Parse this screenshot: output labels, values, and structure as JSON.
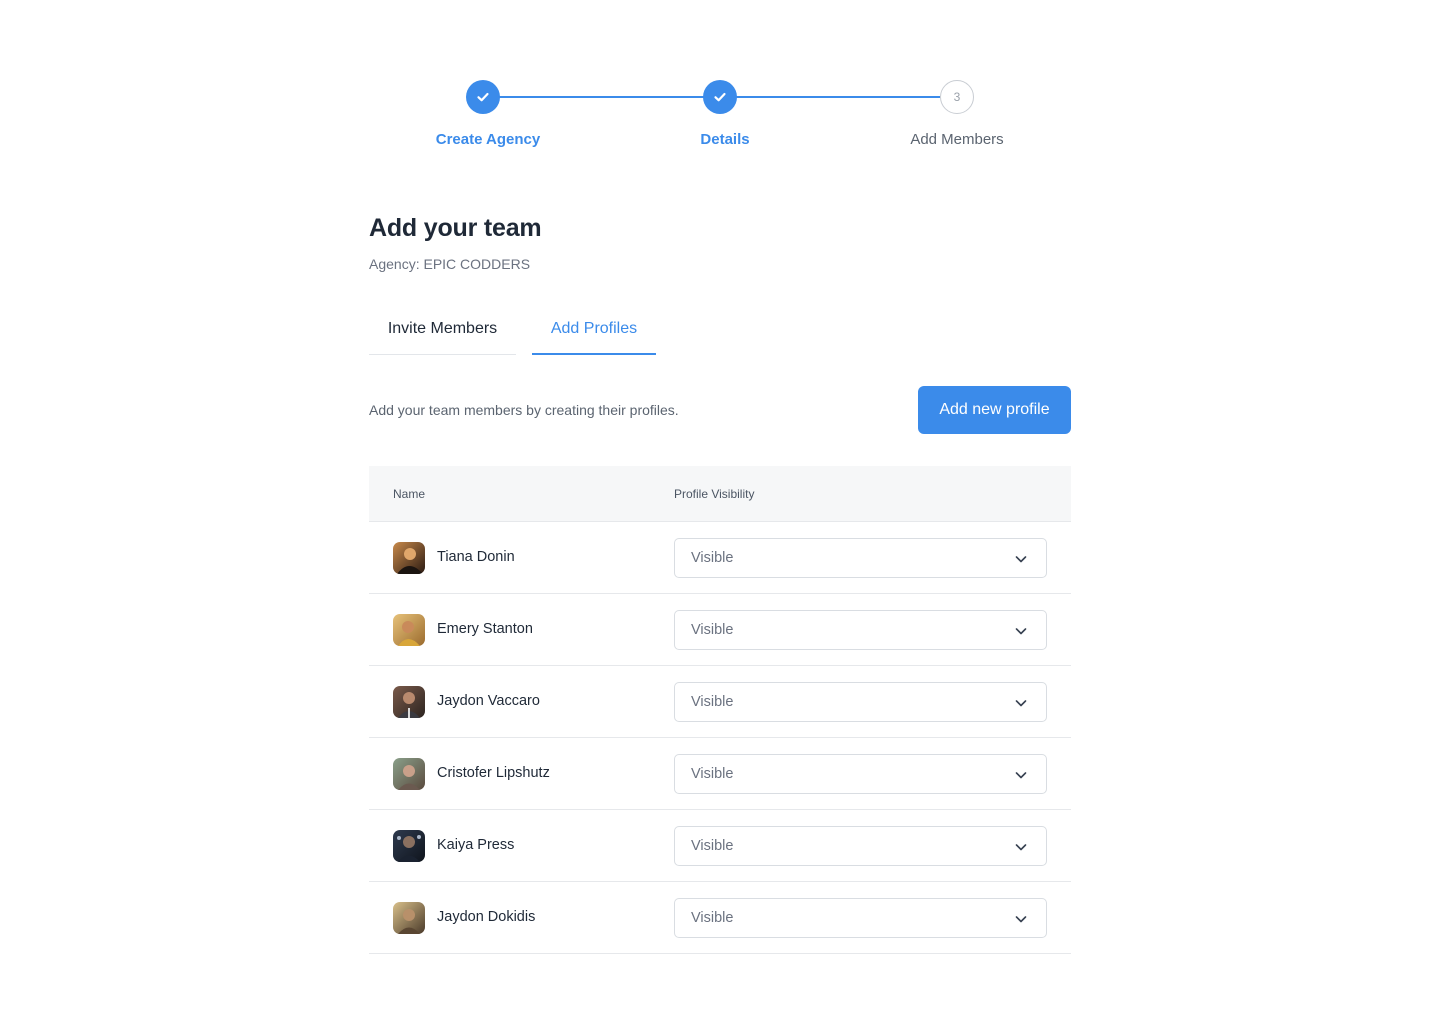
{
  "stepper": {
    "steps": [
      {
        "label": "Create Agency",
        "state": "done"
      },
      {
        "label": "Details",
        "state": "done"
      },
      {
        "label": "Add Members",
        "state": "upcoming",
        "number": "3"
      }
    ]
  },
  "header": {
    "title": "Add your team",
    "agency": "Agency: EPIC CODDERS"
  },
  "tabs": [
    {
      "label": "Invite Members",
      "active": false
    },
    {
      "label": "Add Profiles",
      "active": true
    }
  ],
  "toolbar": {
    "description": "Add your team members by creating their profiles.",
    "add_button_label": "Add new profile"
  },
  "table": {
    "columns": [
      "Name",
      "Profile Visibility"
    ],
    "rows": [
      {
        "name": "Tiana Donin",
        "visibility": "Visible"
      },
      {
        "name": "Emery Stanton",
        "visibility": "Visible"
      },
      {
        "name": "Jaydon Vaccaro",
        "visibility": "Visible"
      },
      {
        "name": "Cristofer Lipshutz",
        "visibility": "Visible"
      },
      {
        "name": "Kaiya Press",
        "visibility": "Visible"
      },
      {
        "name": "Jaydon Dokidis",
        "visibility": "Visible"
      }
    ]
  },
  "colors": {
    "accent": "#3b8bea",
    "text_primary": "#1f2937",
    "text_muted": "#6b7280",
    "table_header_bg": "#f6f7f8"
  }
}
